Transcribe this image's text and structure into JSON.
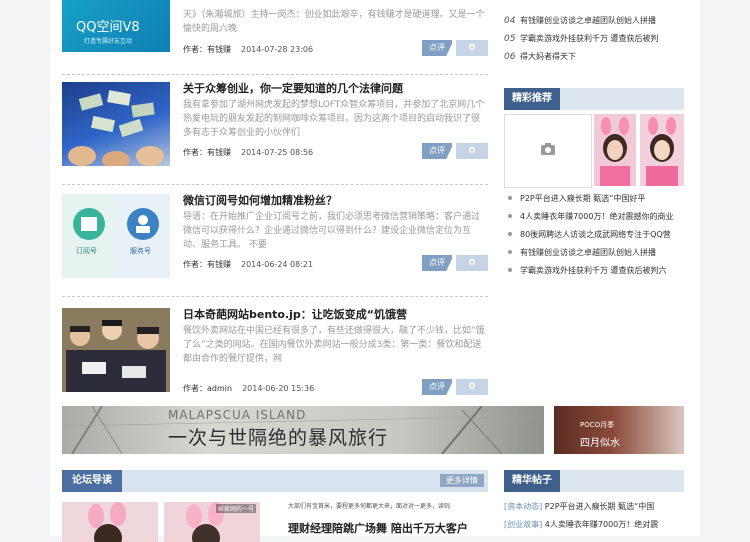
{
  "articles": [
    {
      "title": "",
      "summary": "天》（朱瀚城旅）主持一岗杰：创业如此艰辛，有钱赚才是硬道理。又是一个愉快的周六晚",
      "author_label": "作者：有钱赚",
      "date": "2014-07-28 23:06",
      "comment_label": "点评",
      "comment_count": "0",
      "thumb_text": "QQ空间V8",
      "thumb_subtext": "打造专属好友互动"
    },
    {
      "title": "关于众筹创业，你一定要知道的几个法律问题",
      "summary": "我有拿参加了湖州网虎发起的梦想LOFT众智众筹项目，并参加了北京网几个热爱电玩的朋友发起的制网咖啡众筹项目。因为这两个项目的启动我识了很多有志于众筹创业的小伙伴们",
      "author_label": "作者：有钱赚",
      "date": "2014-07-25 08:56",
      "comment_label": "点评",
      "comment_count": "0"
    },
    {
      "title": "微信订阅号如何增加精准粉丝？",
      "summary": "导语：在开始推广企业订阅号之前，我们必须思考微信营销策略：客户通过微信可以获得什么？企业通过微信可以得到什么？建设企业微信定位为互动、服务工具。 不要",
      "author_label": "作者：有钱赚",
      "date": "2014-06-24 08:21",
      "comment_label": "点评",
      "comment_count": "0",
      "thumb_labels": [
        "订阅号",
        "服务号"
      ]
    },
    {
      "title": "日本奇葩网站bento.jp：让吃饭变成“饥饿营",
      "summary": "餐饮外卖网站在中国已经有很多了，有些还做得很大，融了不少钱，比如“饿了么”之类的网站。在国内餐饮外卖网站一般分成3类：第一类：餐饮和配送都由合作的餐厅提供，网",
      "author_label": "作者：admin",
      "date": "2014-06-20 15:36",
      "comment_label": "点评",
      "comment_count": "0"
    }
  ],
  "banner": {
    "en_text": "MALAPSCUA ISLAND",
    "cn_text": "一次与世隔绝的暴风旅行",
    "side_brand": "POCO月季",
    "side_text": "四月似水"
  },
  "forum": {
    "title": "论坛导读",
    "more": "更多详情",
    "headline_small": "大部们有宝首米，要程更多何都更大来，面对对一更多，读则",
    "headline": "理财经理陪跳广场舞 陪出千万大客户",
    "img_caption": "丝家网的一号"
  },
  "sidebar": {
    "top_list": [
      {
        "num": "04",
        "text": "有钱赚创业访谈之卓越团队创始人拼播"
      },
      {
        "num": "05",
        "text": "学霸卖游戏外挂获利千万 遭查获后被判"
      },
      {
        "num": "06",
        "text": "得大妈者得天下"
      }
    ],
    "recommend_title": "精彩推荐",
    "recommend_list": [
      "P2P平台进入瘊长期 甄选“中国好平",
      "4人卖睡衣年赚7000万！绝对震撼你的商业",
      "80後网聘达人访谈之成武网络专注于QQ营",
      "有钱赚创业访谈之卓越团队创始人拼播",
      "学霸卖游戏外挂获利千万 遭查获后被判六"
    ],
    "essence_title": "精华帖子",
    "essence_list": [
      {
        "tag": "[资本动态]",
        "text": "P2P平台进入瘊长期 甄选“中国"
      },
      {
        "tag": "[创业故事]",
        "text": "4人卖睡衣年赚7000万！绝对震"
      }
    ]
  }
}
